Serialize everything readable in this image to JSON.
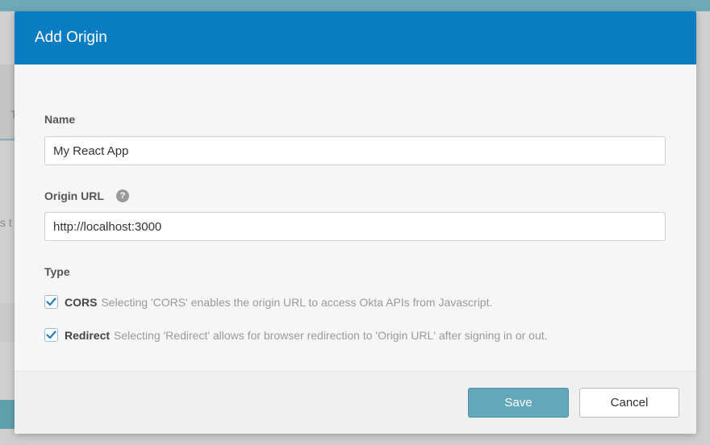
{
  "dialog": {
    "title": "Add Origin"
  },
  "form": {
    "name_label": "Name",
    "name_value": "My React App",
    "origin_url_label": "Origin URL",
    "origin_url_value": "http://localhost:3000",
    "help_icon_glyph": "?",
    "type_label": "Type",
    "options": [
      {
        "name": "CORS",
        "description": "Selecting 'CORS' enables the origin URL to access Okta APIs from Javascript.",
        "checked": true
      },
      {
        "name": "Redirect",
        "description": "Selecting 'Redirect' allows for browser redirection to 'Origin URL' after signing in or out.",
        "checked": true
      }
    ]
  },
  "footer": {
    "save_label": "Save",
    "cancel_label": "Cancel"
  },
  "background": {
    "partial_text_1": "T",
    "partial_text_2": "s t"
  },
  "colors": {
    "header": "#0a7dc2",
    "save_button": "#62a8ba",
    "checkbox_check": "#1f7db8"
  },
  "icons": {
    "help": "question-circle-icon",
    "checkbox": "checkmark-icon"
  }
}
